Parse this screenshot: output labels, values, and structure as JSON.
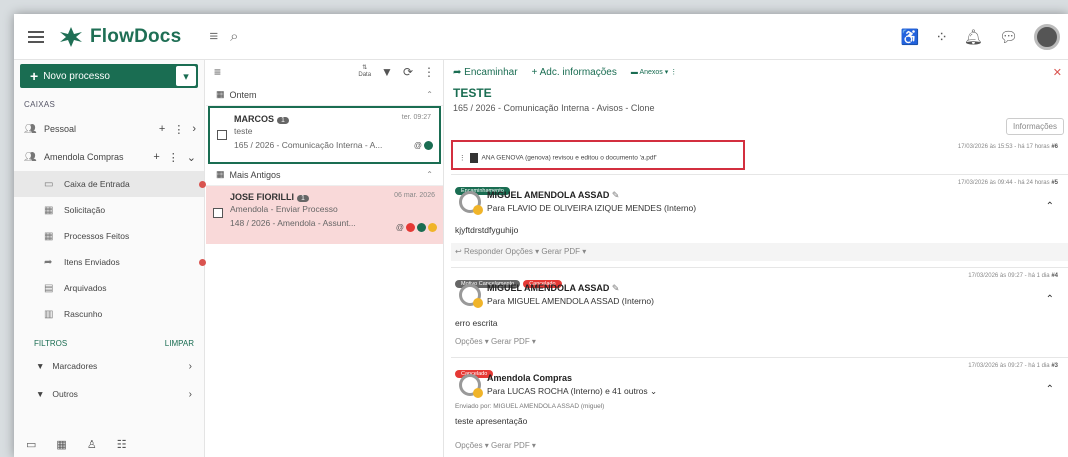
{
  "app": {
    "name": "FlowDocs"
  },
  "sidebar": {
    "new_process": "Novo processo",
    "caixas_title": "CAIXAS",
    "boxes": [
      {
        "label": "Pessoal"
      },
      {
        "label": "Amendola Compras"
      }
    ],
    "subitems": [
      {
        "label": "Caixa de Entrada"
      },
      {
        "label": "Solicitação"
      },
      {
        "label": "Processos Feitos"
      },
      {
        "label": "Itens Enviados"
      },
      {
        "label": "Arquivados"
      },
      {
        "label": "Rascunho"
      }
    ],
    "filters_title": "FILTROS",
    "clear": "LIMPAR",
    "filters": [
      {
        "label": "Marcadores"
      },
      {
        "label": "Outros"
      }
    ]
  },
  "list": {
    "sort_label": "Data",
    "group_yesterday": "Ontem",
    "group_older": "Mais Antigos",
    "cards": [
      {
        "name": "MARCOS",
        "count": "1",
        "date": "ter. 09:27",
        "line2": "teste",
        "line3": "165 / 2026 - Comunicação Interna - A..."
      },
      {
        "name": "JOSE FIORILLI",
        "count": "1",
        "date": "06 mar. 2026",
        "line2": "Amendola - Enviar Processo",
        "line3": "148 / 2026 - Amendola - Assunt..."
      }
    ]
  },
  "detail": {
    "actions": {
      "forward": "Encaminhar",
      "add_info": "Adc. informações",
      "attachments": "Anexos"
    },
    "title": "TESTE",
    "subtitle": "165 / 2026 - Comunicação Interna - Avisos - Clone",
    "info_button": "Informações",
    "highlight": {
      "text": "ANA GENOVA (genova) revisou e editou o documento 'a.pdf'",
      "meta": "17/03/2026 às 15:53 - há 17 horas",
      "num": "#6"
    },
    "messages": [
      {
        "badges": [
          "Encaminhamento"
        ],
        "meta": "17/03/2026 às 09:44 - há 24 horas",
        "num": "#5",
        "sender": "MIGUEL AMENDOLA ASSAD",
        "to": "Para FLAVIO DE OLIVEIRA IZIQUE MENDES (Interno)",
        "body": "kjyftdrstdfyguhijo",
        "options": "Responder   Opções  ▾   Gerar PDF  ▾"
      },
      {
        "badges": [
          "Motivo Cancelamento",
          "Cancelado"
        ],
        "meta": "17/03/2026 às 09:27 - há 1 dia",
        "num": "#4",
        "sender": "MIGUEL AMENDOLA ASSAD",
        "to": "Para MIGUEL AMENDOLA ASSAD (Interno)",
        "body": "erro escrita",
        "options": "Opções  ▾   Gerar PDF  ▾"
      },
      {
        "badges": [
          "Cancelado"
        ],
        "meta": "17/03/2026 às 09:27 - há 1 dia",
        "num": "#3",
        "sender": "Amendola Compras",
        "to": "Para LUCAS ROCHA (Interno) e 41 outros",
        "sent_by": "Enviado por: MIGUEL AMENDOLA ASSAD (miguel)",
        "body": "teste apresentação",
        "options": "Opções  ▾   Gerar PDF  ▾"
      }
    ]
  },
  "colors": {
    "brand": "#1a6d52",
    "highlight": "#d32f3f",
    "cancel": "#e53935"
  }
}
